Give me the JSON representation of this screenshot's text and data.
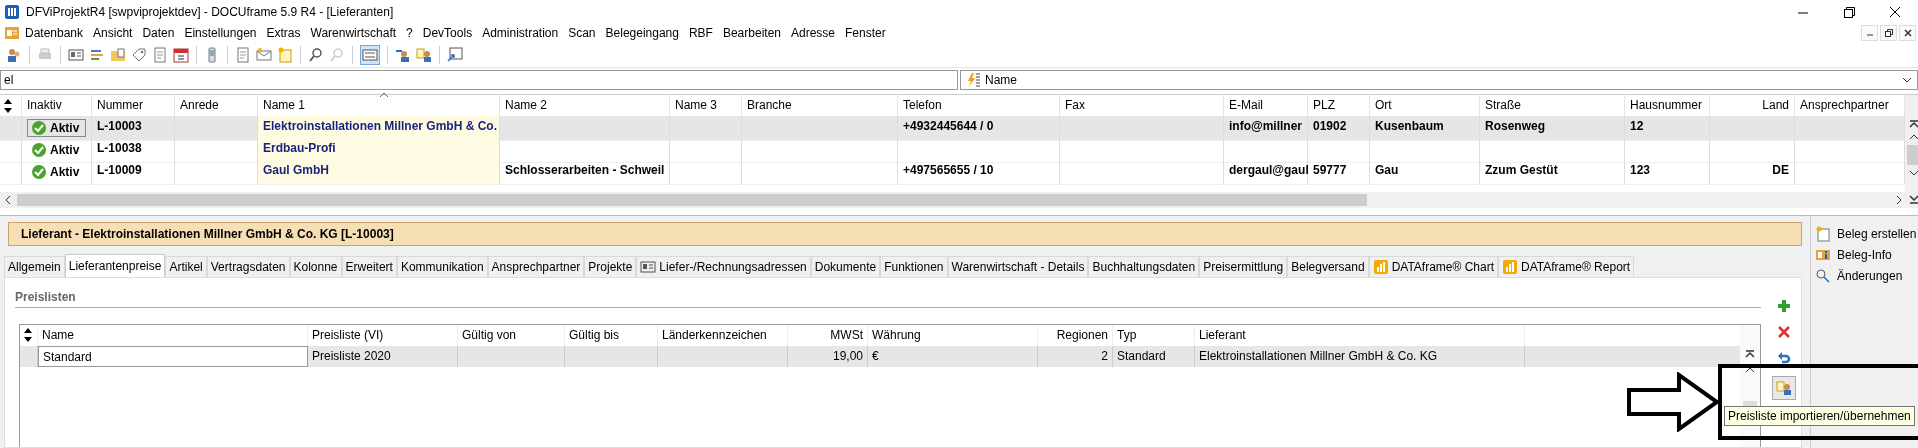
{
  "window": {
    "title": "DFViProjektR4 [swpviprojektdev] - DOCUframe 5.9 R4 - [Lieferanten]"
  },
  "menu": [
    "Datenbank",
    "Ansicht",
    "Daten",
    "Einstellungen",
    "Extras",
    "Warenwirtschaft",
    "?",
    "DevTools",
    "Administration",
    "Scan",
    "Belegeingang",
    "RBF",
    "Bearbeiten",
    "Adresse",
    "Fenster"
  ],
  "filter": {
    "value": "el",
    "search_by": "Name"
  },
  "grid": {
    "columns": [
      {
        "label": "Inaktiv",
        "sorted": false
      },
      {
        "label": "Nummer",
        "sorted": false
      },
      {
        "label": "Anrede",
        "sorted": false
      },
      {
        "label": "Name 1",
        "sorted": true
      },
      {
        "label": "Name 2",
        "sorted": false
      },
      {
        "label": "Name 3",
        "sorted": false
      },
      {
        "label": "Branche",
        "sorted": false
      },
      {
        "label": "Telefon",
        "sorted": false
      },
      {
        "label": "Fax",
        "sorted": false
      },
      {
        "label": "E-Mail",
        "sorted": false
      },
      {
        "label": "PLZ",
        "sorted": false
      },
      {
        "label": "Ort",
        "sorted": false
      },
      {
        "label": "Straße",
        "sorted": false
      },
      {
        "label": "Hausnummer",
        "sorted": false
      },
      {
        "label": "Land",
        "sorted": false
      },
      {
        "label": "Ansprechpartner",
        "sorted": false
      }
    ],
    "rows": [
      {
        "selected": true,
        "active": true,
        "cells": [
          "Aktiv",
          "L-10003",
          "",
          "Elektroinstallationen Millner GmbH & Co.",
          "",
          "",
          "",
          "+4932445644 / 0",
          "",
          "info@millner",
          "01902",
          "Kusenbaum",
          "Rosenweg",
          "12",
          "",
          ""
        ]
      },
      {
        "selected": false,
        "active": true,
        "cells": [
          "Aktiv",
          "L-10038",
          "",
          "Erdbau-Profi",
          "",
          "",
          "",
          "",
          "",
          "",
          "",
          "",
          "",
          "",
          "",
          ""
        ]
      },
      {
        "selected": false,
        "active": true,
        "cells": [
          "Aktiv",
          "L-10009",
          "",
          "Gaul GmbH",
          "Schlosserarbeiten - Schweil",
          "",
          "",
          "+497565655 / 10",
          "",
          "dergaul@gaul",
          "59777",
          "Gau",
          "Zzum Gestüt",
          "123",
          "DE",
          ""
        ]
      }
    ]
  },
  "detail": {
    "title": "Lieferant  -  Elektroinstallationen Millner GmbH & Co. KG [L-10003]",
    "tabs": [
      {
        "label": "Allgemein",
        "selected": false,
        "kind": "plain"
      },
      {
        "label": "Lieferantenpreise",
        "selected": true,
        "kind": "plain"
      },
      {
        "label": "Artikel",
        "selected": false,
        "kind": "plain"
      },
      {
        "label": "Vertragsdaten",
        "selected": false,
        "kind": "plain"
      },
      {
        "label": "Kolonne",
        "selected": false,
        "kind": "plain"
      },
      {
        "label": "Erweitert",
        "selected": false,
        "kind": "plain"
      },
      {
        "label": "Kommunikation",
        "selected": false,
        "kind": "plain"
      },
      {
        "label": "Ansprechpartner",
        "selected": false,
        "kind": "plain"
      },
      {
        "label": "Projekte",
        "selected": false,
        "kind": "plain"
      },
      {
        "label": "Liefer-/Rechnungsadressen",
        "selected": false,
        "kind": "card"
      },
      {
        "label": "Dokumente",
        "selected": false,
        "kind": "plain"
      },
      {
        "label": "Funktionen",
        "selected": false,
        "kind": "plain"
      },
      {
        "label": "Warenwirtschaft - Details",
        "selected": false,
        "kind": "plain"
      },
      {
        "label": "Buchhaltungsdaten",
        "selected": false,
        "kind": "plain"
      },
      {
        "label": "Preisermittlung",
        "selected": false,
        "kind": "plain"
      },
      {
        "label": "Belegversand",
        "selected": false,
        "kind": "plain"
      },
      {
        "label": "DATAframe® Chart",
        "selected": false,
        "kind": "chart"
      },
      {
        "label": "DATAframe® Report",
        "selected": false,
        "kind": "chart"
      }
    ],
    "section": "Preislisten",
    "table": {
      "columns": [
        "Name",
        "Preisliste (VI)",
        "Gültig von",
        "Gültig bis",
        "Länderkennzeichen",
        "MWSt",
        "Währung",
        "Regionen",
        "Typ",
        "Lieferant"
      ],
      "rows": [
        {
          "selected": true,
          "cells": [
            "Standard",
            "Preisliste 2020",
            "",
            "",
            "",
            "19,00",
            "€",
            "2",
            "Standard",
            "Elektroinstallationen Millner GmbH & Co. KG"
          ]
        }
      ]
    },
    "tooltip": "Preisliste importieren/übernehmen"
  },
  "side_panel": [
    "Beleg erstellen",
    "Beleg-Info",
    "Änderungen"
  ]
}
